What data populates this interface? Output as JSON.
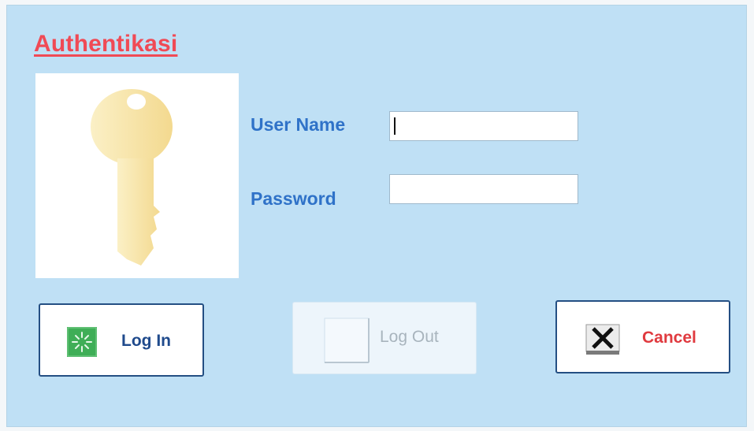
{
  "window": {
    "title": "Authentikasi",
    "title_color": "#f04a55",
    "background_color": "#bfe0f5"
  },
  "form": {
    "username_label": "User Name",
    "username_value": "",
    "password_label": "Password",
    "password_value": "",
    "label_color": "#2f72c8"
  },
  "image": {
    "icon": "key-icon",
    "key_color": "#f7e6a8"
  },
  "buttons": {
    "login": {
      "label": "Log In",
      "icon": "login-icon",
      "enabled": true
    },
    "logout": {
      "label": "Log Out",
      "icon": "blank-icon",
      "enabled": false
    },
    "cancel": {
      "label": "Cancel",
      "icon": "close-icon",
      "enabled": true,
      "label_color": "#e03a3f"
    }
  }
}
